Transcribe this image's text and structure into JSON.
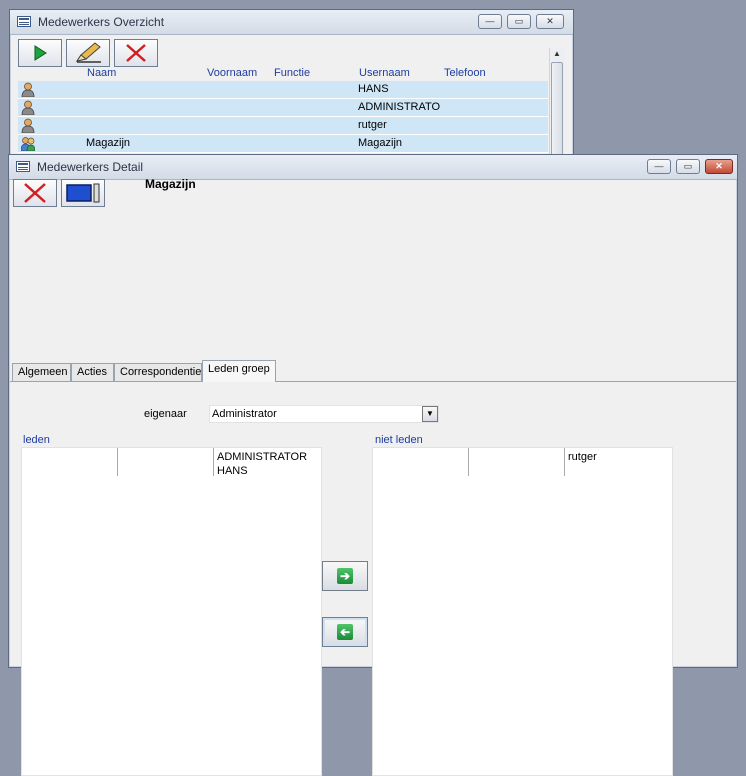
{
  "overview": {
    "title": "Medewerkers Overzicht",
    "columns": [
      "Naam",
      "Voornaam",
      "Functie",
      "Usernaam",
      "Telefoon"
    ],
    "rows": [
      {
        "naam": "",
        "usernaam": "HANS",
        "icon": "user-icon"
      },
      {
        "naam": "",
        "usernaam": "ADMINISTRATO",
        "icon": "user-icon"
      },
      {
        "naam": "",
        "usernaam": "rutger",
        "icon": "user-icon"
      },
      {
        "naam": "Magazijn",
        "usernaam": "Magazijn",
        "icon": "group-icon"
      }
    ]
  },
  "detail": {
    "title": "Medewerkers Detail",
    "record_name": "Magazijn",
    "tabs": [
      "Algemeen",
      "Acties",
      "Correspondentie",
      "Leden groep"
    ],
    "active_tab": "Leden groep",
    "owner_label": "eigenaar",
    "owner_value": "Administrator",
    "members_label": "leden",
    "members": [
      "ADMINISTRATOR",
      "HANS"
    ],
    "non_members_label": "niet leden",
    "non_members": [
      "rutger"
    ]
  },
  "colors": {
    "row_highlight": "#cfe6f7",
    "header_text": "#1e3ca0",
    "accent_green": "#1b8a36",
    "delete_red": "#d11f1f"
  }
}
